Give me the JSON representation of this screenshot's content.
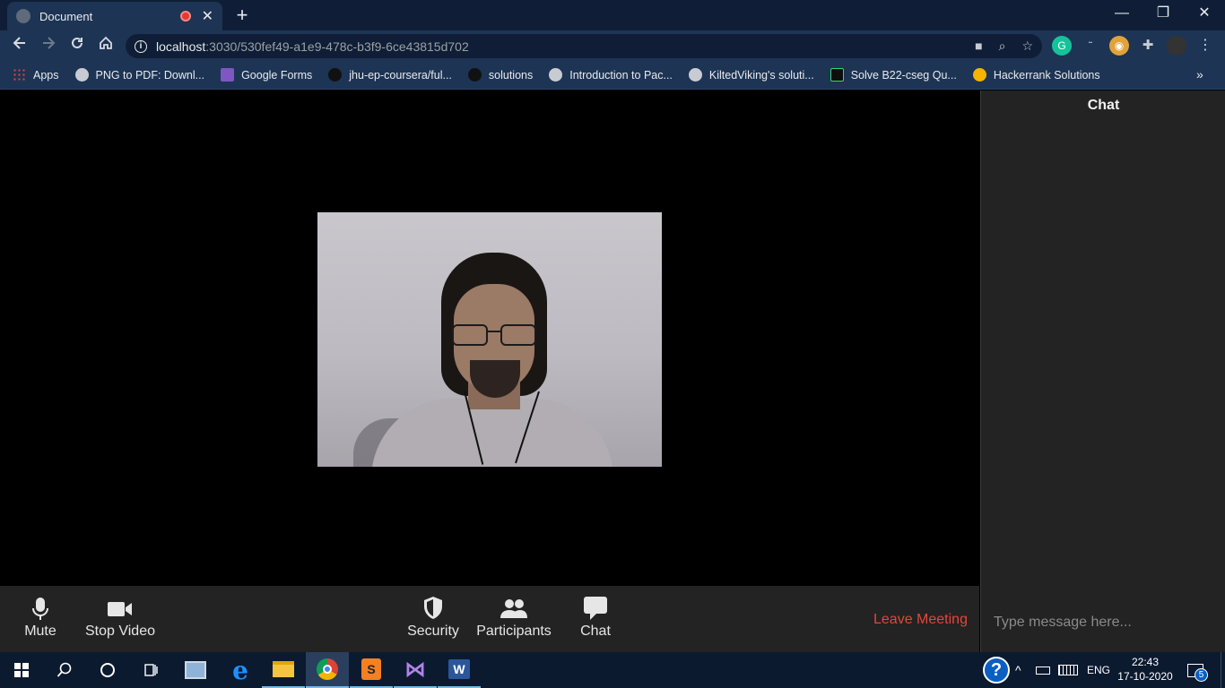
{
  "browser": {
    "tab": {
      "title": "Document"
    },
    "url": {
      "host": "localhost",
      "path": ":3030/530fef49-a1e9-478c-b3f9-6ce43815d702"
    },
    "bookmarks": [
      {
        "label": "Apps",
        "icon": "apps-grid-icon"
      },
      {
        "label": "PNG to PDF: Downl...",
        "icon": "globe-icon"
      },
      {
        "label": "Google Forms",
        "icon": "google-forms-icon"
      },
      {
        "label": "jhu-ep-coursera/ful...",
        "icon": "github-icon"
      },
      {
        "label": "solutions",
        "icon": "github-icon"
      },
      {
        "label": "Introduction to Pac...",
        "icon": "globe-icon"
      },
      {
        "label": "KiltedViking's soluti...",
        "icon": "globe-icon"
      },
      {
        "label": "Solve B22-cseg Qu...",
        "icon": "hackerrank-icon"
      },
      {
        "label": "Hackerrank Solutions",
        "icon": "emoji-icon"
      }
    ]
  },
  "meeting": {
    "controls": {
      "mute": "Mute",
      "stop_video": "Stop Video",
      "security": "Security",
      "participants": "Participants",
      "chat": "Chat",
      "leave": "Leave Meeting"
    },
    "chat": {
      "title": "Chat",
      "placeholder": "Type message here..."
    }
  },
  "taskbar": {
    "language": "ENG",
    "time": "22:43",
    "date": "17-10-2020",
    "notifications": "5"
  },
  "colors": {
    "leave": "#e5453a",
    "chrome_frame": "#0f1e36",
    "chrome_toolbar": "#1d3454",
    "meeting_bar": "#232323"
  }
}
